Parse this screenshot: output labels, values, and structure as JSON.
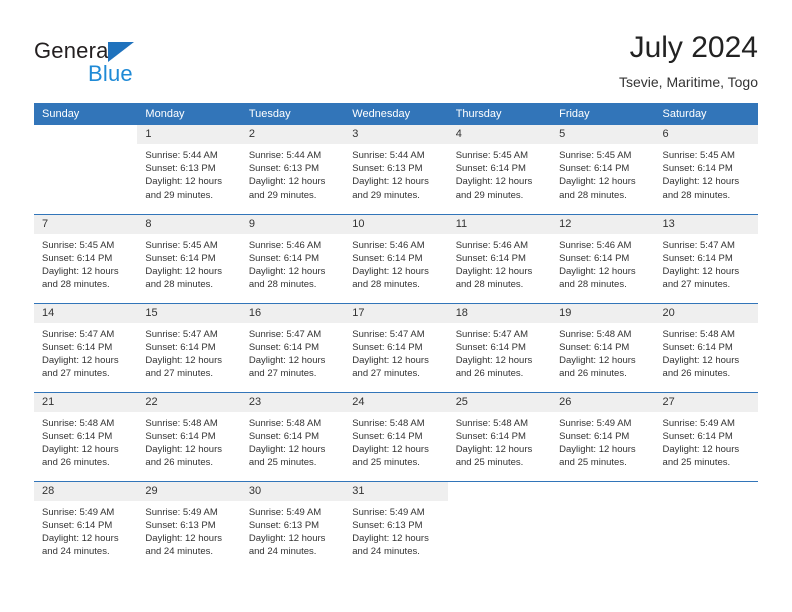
{
  "brand": {
    "name_part1": "General",
    "name_part2": "Blue",
    "triangle_icon": "triangle-icon",
    "color_dark": "#231f20",
    "color_blue": "#1f8ad6",
    "color_triangle": "#1f72bd"
  },
  "header": {
    "month_title": "July 2024",
    "location": "Tsevie, Maritime, Togo"
  },
  "theme": {
    "header_band": "#3275b9",
    "daynum_band": "#efefef",
    "text": "#333333",
    "page_bg": "#ffffff"
  },
  "calendar": {
    "weekday_headers": [
      "Sunday",
      "Monday",
      "Tuesday",
      "Wednesday",
      "Thursday",
      "Friday",
      "Saturday"
    ],
    "labels": {
      "sunrise_prefix": "Sunrise:",
      "sunset_prefix": "Sunset:",
      "daylight_prefix": "Daylight:"
    },
    "weeks": [
      [
        {
          "day": "",
          "sunrise": "",
          "sunset": "",
          "daylight_line1": "",
          "daylight_line2": ""
        },
        {
          "day": "1",
          "sunrise": "Sunrise: 5:44 AM",
          "sunset": "Sunset: 6:13 PM",
          "daylight_line1": "Daylight: 12 hours",
          "daylight_line2": "and 29 minutes."
        },
        {
          "day": "2",
          "sunrise": "Sunrise: 5:44 AM",
          "sunset": "Sunset: 6:13 PM",
          "daylight_line1": "Daylight: 12 hours",
          "daylight_line2": "and 29 minutes."
        },
        {
          "day": "3",
          "sunrise": "Sunrise: 5:44 AM",
          "sunset": "Sunset: 6:13 PM",
          "daylight_line1": "Daylight: 12 hours",
          "daylight_line2": "and 29 minutes."
        },
        {
          "day": "4",
          "sunrise": "Sunrise: 5:45 AM",
          "sunset": "Sunset: 6:14 PM",
          "daylight_line1": "Daylight: 12 hours",
          "daylight_line2": "and 29 minutes."
        },
        {
          "day": "5",
          "sunrise": "Sunrise: 5:45 AM",
          "sunset": "Sunset: 6:14 PM",
          "daylight_line1": "Daylight: 12 hours",
          "daylight_line2": "and 28 minutes."
        },
        {
          "day": "6",
          "sunrise": "Sunrise: 5:45 AM",
          "sunset": "Sunset: 6:14 PM",
          "daylight_line1": "Daylight: 12 hours",
          "daylight_line2": "and 28 minutes."
        }
      ],
      [
        {
          "day": "7",
          "sunrise": "Sunrise: 5:45 AM",
          "sunset": "Sunset: 6:14 PM",
          "daylight_line1": "Daylight: 12 hours",
          "daylight_line2": "and 28 minutes."
        },
        {
          "day": "8",
          "sunrise": "Sunrise: 5:45 AM",
          "sunset": "Sunset: 6:14 PM",
          "daylight_line1": "Daylight: 12 hours",
          "daylight_line2": "and 28 minutes."
        },
        {
          "day": "9",
          "sunrise": "Sunrise: 5:46 AM",
          "sunset": "Sunset: 6:14 PM",
          "daylight_line1": "Daylight: 12 hours",
          "daylight_line2": "and 28 minutes."
        },
        {
          "day": "10",
          "sunrise": "Sunrise: 5:46 AM",
          "sunset": "Sunset: 6:14 PM",
          "daylight_line1": "Daylight: 12 hours",
          "daylight_line2": "and 28 minutes."
        },
        {
          "day": "11",
          "sunrise": "Sunrise: 5:46 AM",
          "sunset": "Sunset: 6:14 PM",
          "daylight_line1": "Daylight: 12 hours",
          "daylight_line2": "and 28 minutes."
        },
        {
          "day": "12",
          "sunrise": "Sunrise: 5:46 AM",
          "sunset": "Sunset: 6:14 PM",
          "daylight_line1": "Daylight: 12 hours",
          "daylight_line2": "and 28 minutes."
        },
        {
          "day": "13",
          "sunrise": "Sunrise: 5:47 AM",
          "sunset": "Sunset: 6:14 PM",
          "daylight_line1": "Daylight: 12 hours",
          "daylight_line2": "and 27 minutes."
        }
      ],
      [
        {
          "day": "14",
          "sunrise": "Sunrise: 5:47 AM",
          "sunset": "Sunset: 6:14 PM",
          "daylight_line1": "Daylight: 12 hours",
          "daylight_line2": "and 27 minutes."
        },
        {
          "day": "15",
          "sunrise": "Sunrise: 5:47 AM",
          "sunset": "Sunset: 6:14 PM",
          "daylight_line1": "Daylight: 12 hours",
          "daylight_line2": "and 27 minutes."
        },
        {
          "day": "16",
          "sunrise": "Sunrise: 5:47 AM",
          "sunset": "Sunset: 6:14 PM",
          "daylight_line1": "Daylight: 12 hours",
          "daylight_line2": "and 27 minutes."
        },
        {
          "day": "17",
          "sunrise": "Sunrise: 5:47 AM",
          "sunset": "Sunset: 6:14 PM",
          "daylight_line1": "Daylight: 12 hours",
          "daylight_line2": "and 27 minutes."
        },
        {
          "day": "18",
          "sunrise": "Sunrise: 5:47 AM",
          "sunset": "Sunset: 6:14 PM",
          "daylight_line1": "Daylight: 12 hours",
          "daylight_line2": "and 26 minutes."
        },
        {
          "day": "19",
          "sunrise": "Sunrise: 5:48 AM",
          "sunset": "Sunset: 6:14 PM",
          "daylight_line1": "Daylight: 12 hours",
          "daylight_line2": "and 26 minutes."
        },
        {
          "day": "20",
          "sunrise": "Sunrise: 5:48 AM",
          "sunset": "Sunset: 6:14 PM",
          "daylight_line1": "Daylight: 12 hours",
          "daylight_line2": "and 26 minutes."
        }
      ],
      [
        {
          "day": "21",
          "sunrise": "Sunrise: 5:48 AM",
          "sunset": "Sunset: 6:14 PM",
          "daylight_line1": "Daylight: 12 hours",
          "daylight_line2": "and 26 minutes."
        },
        {
          "day": "22",
          "sunrise": "Sunrise: 5:48 AM",
          "sunset": "Sunset: 6:14 PM",
          "daylight_line1": "Daylight: 12 hours",
          "daylight_line2": "and 26 minutes."
        },
        {
          "day": "23",
          "sunrise": "Sunrise: 5:48 AM",
          "sunset": "Sunset: 6:14 PM",
          "daylight_line1": "Daylight: 12 hours",
          "daylight_line2": "and 25 minutes."
        },
        {
          "day": "24",
          "sunrise": "Sunrise: 5:48 AM",
          "sunset": "Sunset: 6:14 PM",
          "daylight_line1": "Daylight: 12 hours",
          "daylight_line2": "and 25 minutes."
        },
        {
          "day": "25",
          "sunrise": "Sunrise: 5:48 AM",
          "sunset": "Sunset: 6:14 PM",
          "daylight_line1": "Daylight: 12 hours",
          "daylight_line2": "and 25 minutes."
        },
        {
          "day": "26",
          "sunrise": "Sunrise: 5:49 AM",
          "sunset": "Sunset: 6:14 PM",
          "daylight_line1": "Daylight: 12 hours",
          "daylight_line2": "and 25 minutes."
        },
        {
          "day": "27",
          "sunrise": "Sunrise: 5:49 AM",
          "sunset": "Sunset: 6:14 PM",
          "daylight_line1": "Daylight: 12 hours",
          "daylight_line2": "and 25 minutes."
        }
      ],
      [
        {
          "day": "28",
          "sunrise": "Sunrise: 5:49 AM",
          "sunset": "Sunset: 6:14 PM",
          "daylight_line1": "Daylight: 12 hours",
          "daylight_line2": "and 24 minutes."
        },
        {
          "day": "29",
          "sunrise": "Sunrise: 5:49 AM",
          "sunset": "Sunset: 6:13 PM",
          "daylight_line1": "Daylight: 12 hours",
          "daylight_line2": "and 24 minutes."
        },
        {
          "day": "30",
          "sunrise": "Sunrise: 5:49 AM",
          "sunset": "Sunset: 6:13 PM",
          "daylight_line1": "Daylight: 12 hours",
          "daylight_line2": "and 24 minutes."
        },
        {
          "day": "31",
          "sunrise": "Sunrise: 5:49 AM",
          "sunset": "Sunset: 6:13 PM",
          "daylight_line1": "Daylight: 12 hours",
          "daylight_line2": "and 24 minutes."
        },
        {
          "day": "",
          "sunrise": "",
          "sunset": "",
          "daylight_line1": "",
          "daylight_line2": ""
        },
        {
          "day": "",
          "sunrise": "",
          "sunset": "",
          "daylight_line1": "",
          "daylight_line2": ""
        },
        {
          "day": "",
          "sunrise": "",
          "sunset": "",
          "daylight_line1": "",
          "daylight_line2": ""
        }
      ]
    ]
  }
}
